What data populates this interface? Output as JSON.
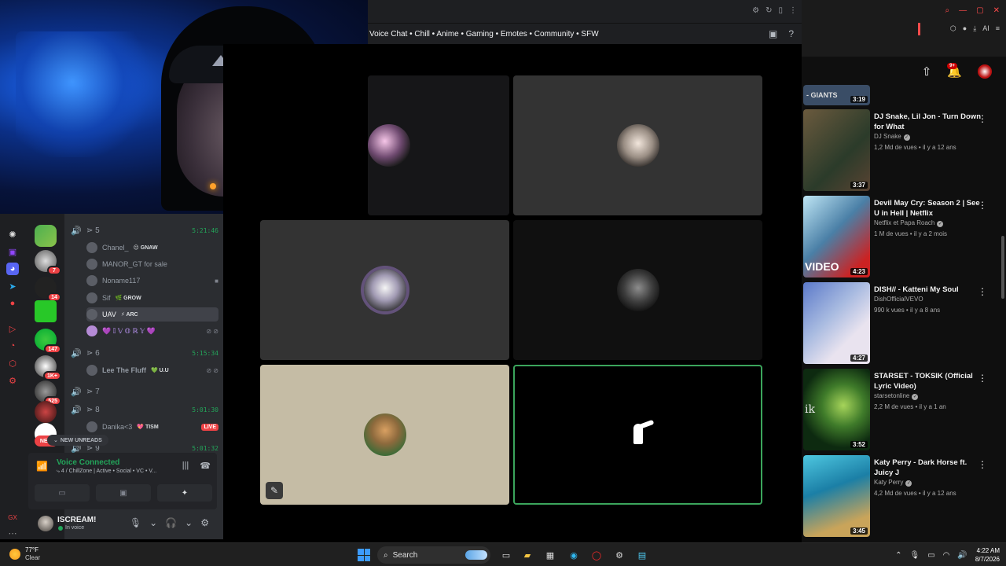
{
  "discord": {
    "channel_topic": "Voice Chat • Chill • Anime • Gaming • Emotes • Community • SFW",
    "voice_channels": [
      {
        "name": "5",
        "time": "5:21:46",
        "active": true
      },
      {
        "name": "6",
        "time": "5:15:34",
        "active": true
      },
      {
        "name": "7",
        "time": "",
        "active": false
      },
      {
        "name": "8",
        "time": "5:01:30",
        "active": true
      },
      {
        "name": "9",
        "time": "5:01:32",
        "active": true
      }
    ],
    "members": [
      {
        "name": "Chanel_",
        "tag": "😐 GNAW"
      },
      {
        "name": "MANOR_GT for sale",
        "tag": ""
      },
      {
        "name": "Noname117",
        "tag": ""
      },
      {
        "name": "Sif",
        "tag": "🌿 GROW"
      },
      {
        "name": "UAV",
        "tag": "⚡ ARC"
      },
      {
        "name": "💜 𝕀 𝕍 𝕆 ℝ 𝕐 💜",
        "tag": ""
      },
      {
        "name": "Lee The Fluff",
        "tag": "💚 U.U"
      },
      {
        "name": "Danika<3",
        "tag": "💖 TISM",
        "live": "LIVE"
      }
    ],
    "guild_badges": [
      "7",
      "14",
      "147",
      "1K+",
      "525"
    ],
    "new_badge": "NEW",
    "new_unreads": "NEW UNREADS",
    "voice_panel": {
      "status": "Voice Connected",
      "channel": "4 / ChillZone | Active • Social • VC • V..."
    },
    "user": {
      "name": "ISCREAM!",
      "status": "In voice"
    }
  },
  "youtube": {
    "notification_count": "9+",
    "partial_title": "- GIANTS",
    "partial_duration": "3:19",
    "videos": [
      {
        "title": "DJ Snake, Lil Jon - Turn Down for What",
        "channel": "DJ Snake",
        "meta": "1,2 Md de vues • il y a 12 ans",
        "duration": "3:37",
        "thumb_text": ""
      },
      {
        "title": "Devil May Cry: Season 2 | See U in Hell | Netflix",
        "channel": "Netflix et Papa Roach",
        "meta": "1 M de vues • il y a 2 mois",
        "duration": "4:23",
        "thumb_text": "VIDEO"
      },
      {
        "title": "DISH// - Katteni My Soul",
        "channel": "DishOfficialVEVO",
        "meta": "990 k vues • il y a 8 ans",
        "duration": "4:27",
        "thumb_text": ""
      },
      {
        "title": "STARSET - TOKSIK (Official Lyric Video)",
        "channel": "starsetonline",
        "meta": "2,2 M de vues • il y a 1 an",
        "duration": "3:52",
        "thumb_text": "ik"
      },
      {
        "title": "Katy Perry - Dark Horse ft. Juicy J",
        "channel": "Katy Perry",
        "meta": "4,2 Md de vues • il y a 12 ans",
        "duration": "3:45",
        "thumb_text": ""
      }
    ]
  },
  "taskbar": {
    "temperature": "77°F",
    "condition": "Clear",
    "search_placeholder": "Search",
    "time": "4:22 AM",
    "date": "8/7/2026"
  },
  "colors": {
    "discord_green": "#23a55a",
    "discord_red": "#ed4245",
    "youtube_red": "#cc0000",
    "stage_active_border": "#3ba55c"
  }
}
